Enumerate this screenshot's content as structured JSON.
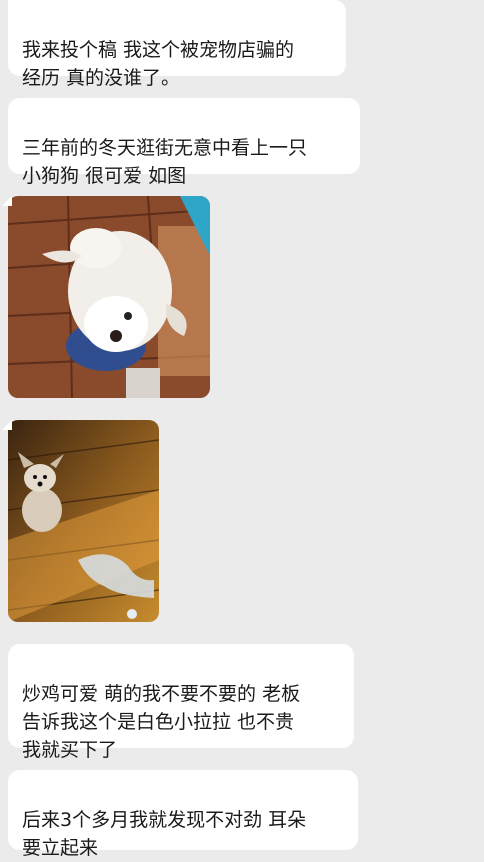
{
  "chat": {
    "messages": [
      {
        "id": "m1",
        "type": "text",
        "text": "我来投个稿 我这个被宠物店骗的\n经历 真的没谁了。"
      },
      {
        "id": "m2",
        "type": "text",
        "text": "三年前的冬天逛街无意中看上一只\n小狗狗 很可爱 如图"
      },
      {
        "id": "m3",
        "type": "image",
        "alt_icon": "white-puppy-photo"
      },
      {
        "id": "m4",
        "type": "image",
        "alt_icon": "puppy-on-wood-floor-photo"
      },
      {
        "id": "m5",
        "type": "text",
        "text": "炒鸡可爱 萌的我不要不要的 老板\n告诉我这个是白色小拉拉 也不贵\n我就买下了"
      },
      {
        "id": "m6",
        "type": "text",
        "text": "后来3个多月我就发现不对劲 耳朵\n要立起来"
      }
    ]
  },
  "colors": {
    "background": "#ebebeb",
    "bubble": "#ffffff",
    "text": "#1a1a1a"
  }
}
